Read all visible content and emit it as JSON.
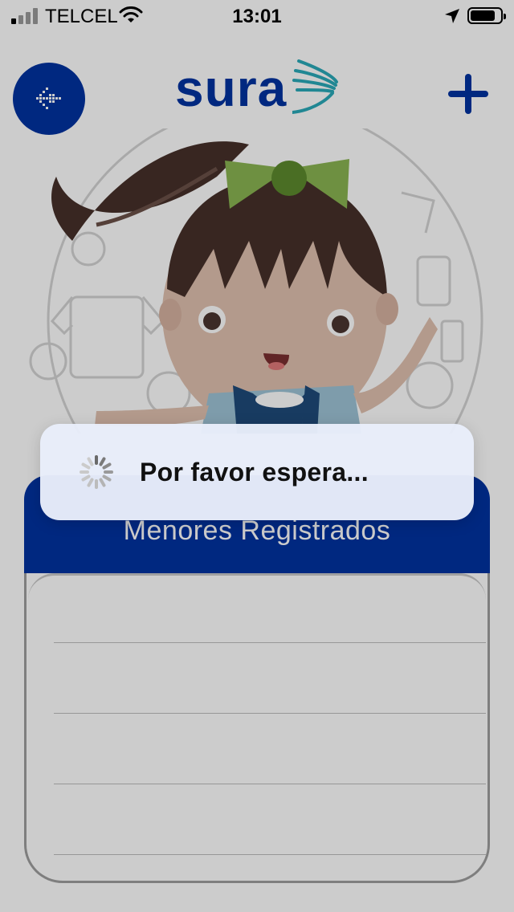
{
  "status_bar": {
    "carrier": "TELCEL",
    "time": "13:01",
    "signal_bars": 4,
    "signal_active_bars": 1,
    "icons": [
      "signal-icon",
      "wifi-icon",
      "location-arrow-icon",
      "battery-icon"
    ]
  },
  "header": {
    "logo_text": "sura",
    "menu_icon": "arrow-left-icon",
    "add_icon": "plus-icon"
  },
  "card": {
    "title": "Menores Registrados",
    "rows": [
      "",
      "",
      "",
      ""
    ]
  },
  "loading": {
    "text": "Por favor espera...",
    "icon": "spinner-icon"
  },
  "colors": {
    "brand_blue": "#0033a0",
    "logo_teal": "#2aa9b8",
    "bow_green": "#8ab552"
  }
}
